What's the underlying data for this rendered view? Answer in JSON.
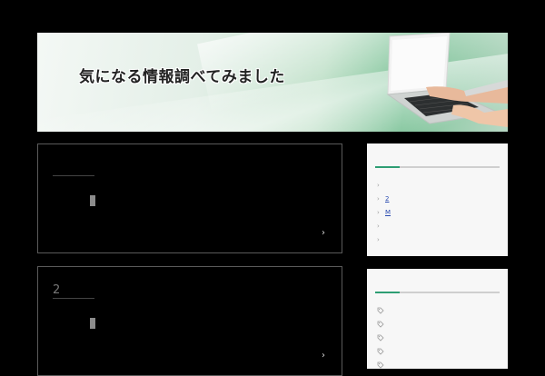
{
  "header": {
    "site_title": "気になる情報調べてみました"
  },
  "posts": [
    {
      "title": "",
      "more_icon": "›"
    },
    {
      "title": "2",
      "more_icon": "›"
    }
  ],
  "sidebar": {
    "recent_links": [
      {
        "label": "",
        "chevron": "›"
      },
      {
        "label": "2",
        "chevron": "›"
      },
      {
        "label": "M",
        "chevron": "›"
      },
      {
        "label": "",
        "chevron": "›"
      },
      {
        "label": "",
        "chevron": "›"
      }
    ],
    "tag_items": [
      {
        "icon": "tag-icon"
      },
      {
        "icon": "tag-icon"
      },
      {
        "icon": "tag-icon"
      },
      {
        "icon": "tag-icon"
      },
      {
        "icon": "tag-icon"
      }
    ],
    "accent_color": "#2e9e73"
  }
}
